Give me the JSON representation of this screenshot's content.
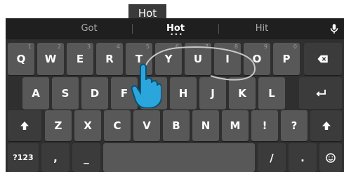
{
  "popup": {
    "text": "Hot"
  },
  "suggestions": [
    {
      "label": "Got"
    },
    {
      "label": "Hot",
      "dots": "•••"
    },
    {
      "label": "Hit"
    }
  ],
  "rows": {
    "r1": [
      {
        "label": "Q",
        "hint": "1"
      },
      {
        "label": "W",
        "hint": "2"
      },
      {
        "label": "E",
        "hint": "3"
      },
      {
        "label": "R",
        "hint": "4"
      },
      {
        "label": "T",
        "hint": "5"
      },
      {
        "label": "Y",
        "hint": "6"
      },
      {
        "label": "U",
        "hint": "7"
      },
      {
        "label": "I",
        "hint": "8"
      },
      {
        "label": "O",
        "hint": "9"
      },
      {
        "label": "P",
        "hint": "0"
      }
    ],
    "r2": [
      {
        "label": "A"
      },
      {
        "label": "S"
      },
      {
        "label": "D"
      },
      {
        "label": "F"
      },
      {
        "label": "G"
      },
      {
        "label": "H"
      },
      {
        "label": "J"
      },
      {
        "label": "K"
      },
      {
        "label": "L"
      }
    ],
    "r3": [
      {
        "label": "Z"
      },
      {
        "label": "X"
      },
      {
        "label": "C"
      },
      {
        "label": "V"
      },
      {
        "label": "B"
      },
      {
        "label": "N"
      },
      {
        "label": "M"
      },
      {
        "label": "!"
      },
      {
        "label": "?"
      }
    ],
    "r4": {
      "symbols": "?123",
      "comma": ",",
      "dash": "_",
      "slash": "/",
      "period": "."
    }
  },
  "icons": {
    "mic": "microphone-icon",
    "backspace": "backspace-icon",
    "enter": "enter-icon",
    "shift": "shift-icon",
    "emoji": "emoji-icon",
    "gesture": "hand-pointer-icon"
  },
  "colors": {
    "keyboard_bg": "#2f2f2f",
    "key": "#585858",
    "key_dark": "#3b3b3b",
    "suggestion_bar": "#1f1f1f",
    "gesture_trail": "#c7c7c7",
    "hand_fill": "#2aa6dc"
  }
}
